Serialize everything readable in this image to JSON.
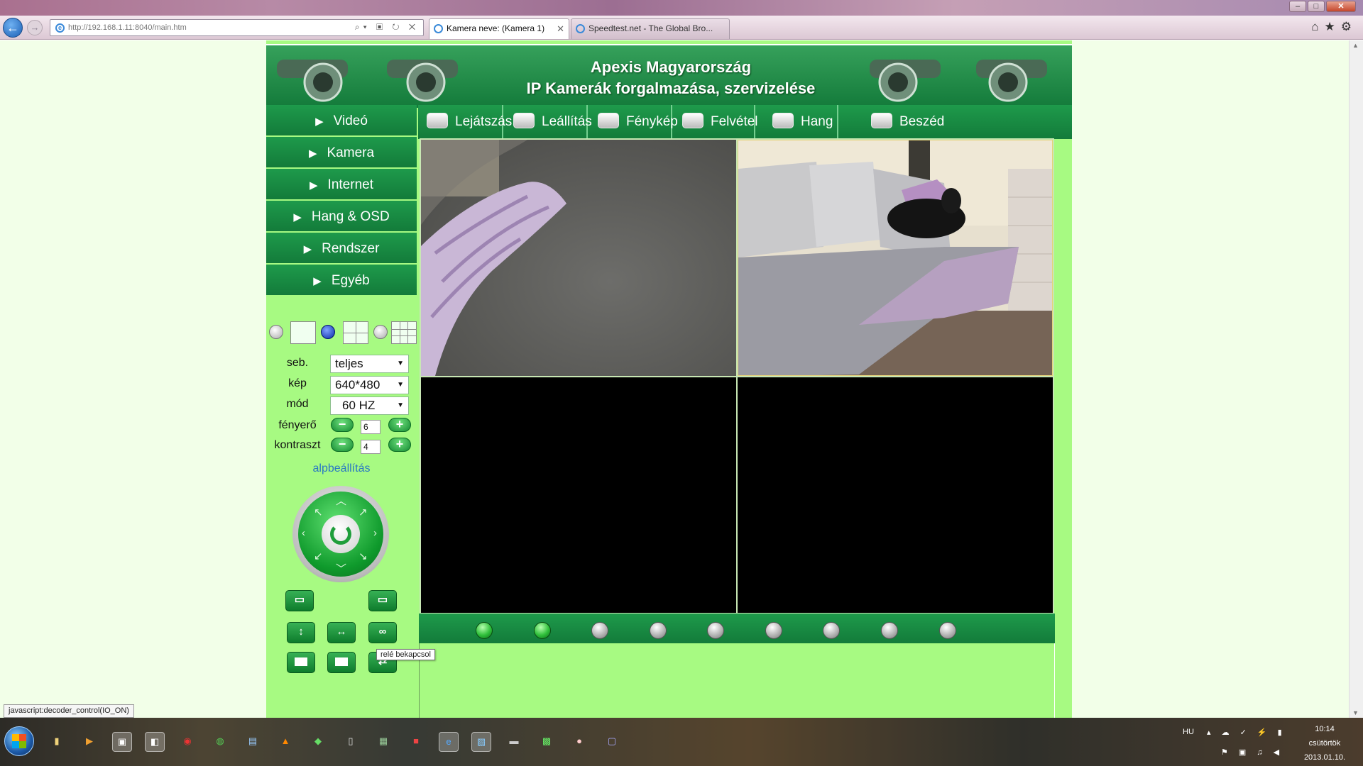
{
  "browser": {
    "address": "http://192.168.1.11:8040/main.htm",
    "tabs": [
      {
        "label": "Kamera neve: (Kamera 1)",
        "active": true
      },
      {
        "label": "Speedtest.net - The Global Bro...",
        "active": false
      }
    ],
    "status_text": "javascript:decoder_control(IO_ON)",
    "tooltip": "relé bekapcsol"
  },
  "banner": {
    "line1": "Apexis Magyarország",
    "line2": "IP Kamerák forgalmazása, szervizelése"
  },
  "menu": [
    {
      "label": "Videó"
    },
    {
      "label": "Kamera"
    },
    {
      "label": "Internet"
    },
    {
      "label": "Hang & OSD"
    },
    {
      "label": "Rendszer"
    },
    {
      "label": "Egyéb"
    }
  ],
  "toolbar": [
    {
      "label": "Lejátszás",
      "icon": "play-icon"
    },
    {
      "label": "Leállítás",
      "icon": "stop-icon"
    },
    {
      "label": "Fénykép",
      "icon": "camera-icon"
    },
    {
      "label": "Felvétel",
      "icon": "record-icon"
    },
    {
      "label": "Hang",
      "icon": "audio-icon"
    },
    {
      "label": "Beszéd",
      "icon": "microphone-icon"
    }
  ],
  "controls": {
    "speed": {
      "label": "seb.",
      "value": "teljes"
    },
    "resolution": {
      "label": "kép",
      "value": "640*480"
    },
    "mode": {
      "label": "mód",
      "value": "60 HZ"
    },
    "brightness": {
      "label": "fényerő",
      "value": "6"
    },
    "contrast": {
      "label": "kontraszt",
      "value": "4"
    },
    "default_link": "alpbeállítás",
    "layout_selected": "4-view"
  },
  "video": {
    "cells": [
      {
        "state": "feed"
      },
      {
        "state": "feed"
      },
      {
        "state": "blank"
      },
      {
        "state": "blank"
      }
    ]
  },
  "channel_dots": [
    {
      "active": true
    },
    {
      "active": true
    },
    {
      "active": false
    },
    {
      "active": false
    },
    {
      "active": false
    },
    {
      "active": false
    },
    {
      "active": false
    },
    {
      "active": false
    },
    {
      "active": false
    }
  ],
  "colors": {
    "brand_green": "#137b3a",
    "page_green": "#a7fa82"
  },
  "taskbar": {
    "lang": "HU",
    "time": "10:14",
    "day": "csütörtök",
    "date": "2013.01.10."
  }
}
